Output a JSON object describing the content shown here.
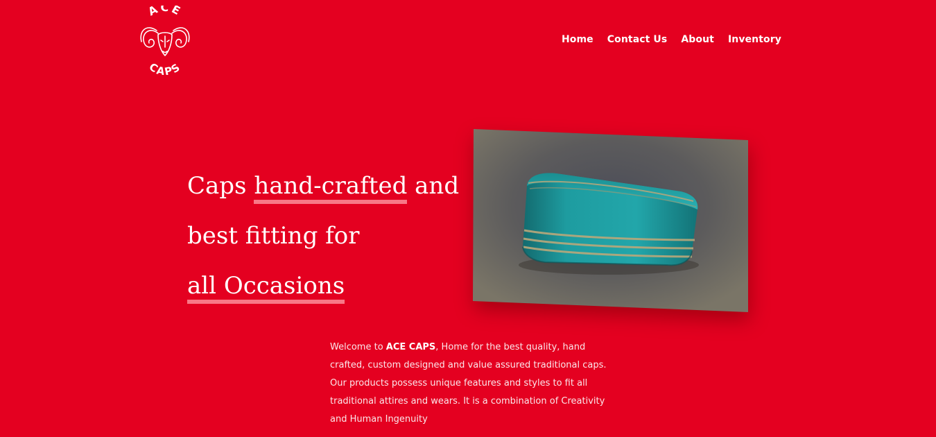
{
  "brand": {
    "logo_top_text": "ACE",
    "logo_bottom_text": "CAPS",
    "logo_icon": "ram-head-icon"
  },
  "nav": {
    "items": [
      {
        "label": "Home"
      },
      {
        "label": "Contact Us"
      },
      {
        "label": "About"
      },
      {
        "label": "Inventory"
      }
    ]
  },
  "hero": {
    "line1_prefix": "Caps ",
    "line1_highlight": "hand-crafted",
    "line1_suffix": " and",
    "line2": "best fitting for",
    "line3_highlight": "all Occasions"
  },
  "product_image": {
    "subject": "teal traditional cap with gold stripes"
  },
  "welcome": {
    "intro": "Welcome to ",
    "brand_name": "ACE CAPS",
    "body": ", Home for the best quality, hand crafted, custom designed and value assured traditional caps. Our products possess unique features and styles to fit all traditional attires and wears. It is a combination of Creativity and Human Ingenuity"
  },
  "colors": {
    "background": "#e40020",
    "text": "#ffffff",
    "highlight_underline": "#ff9aa7",
    "cap_teal": "#1e9ca0",
    "cap_stripe": "#b9a77a",
    "photo_background": "#6f6a60"
  }
}
